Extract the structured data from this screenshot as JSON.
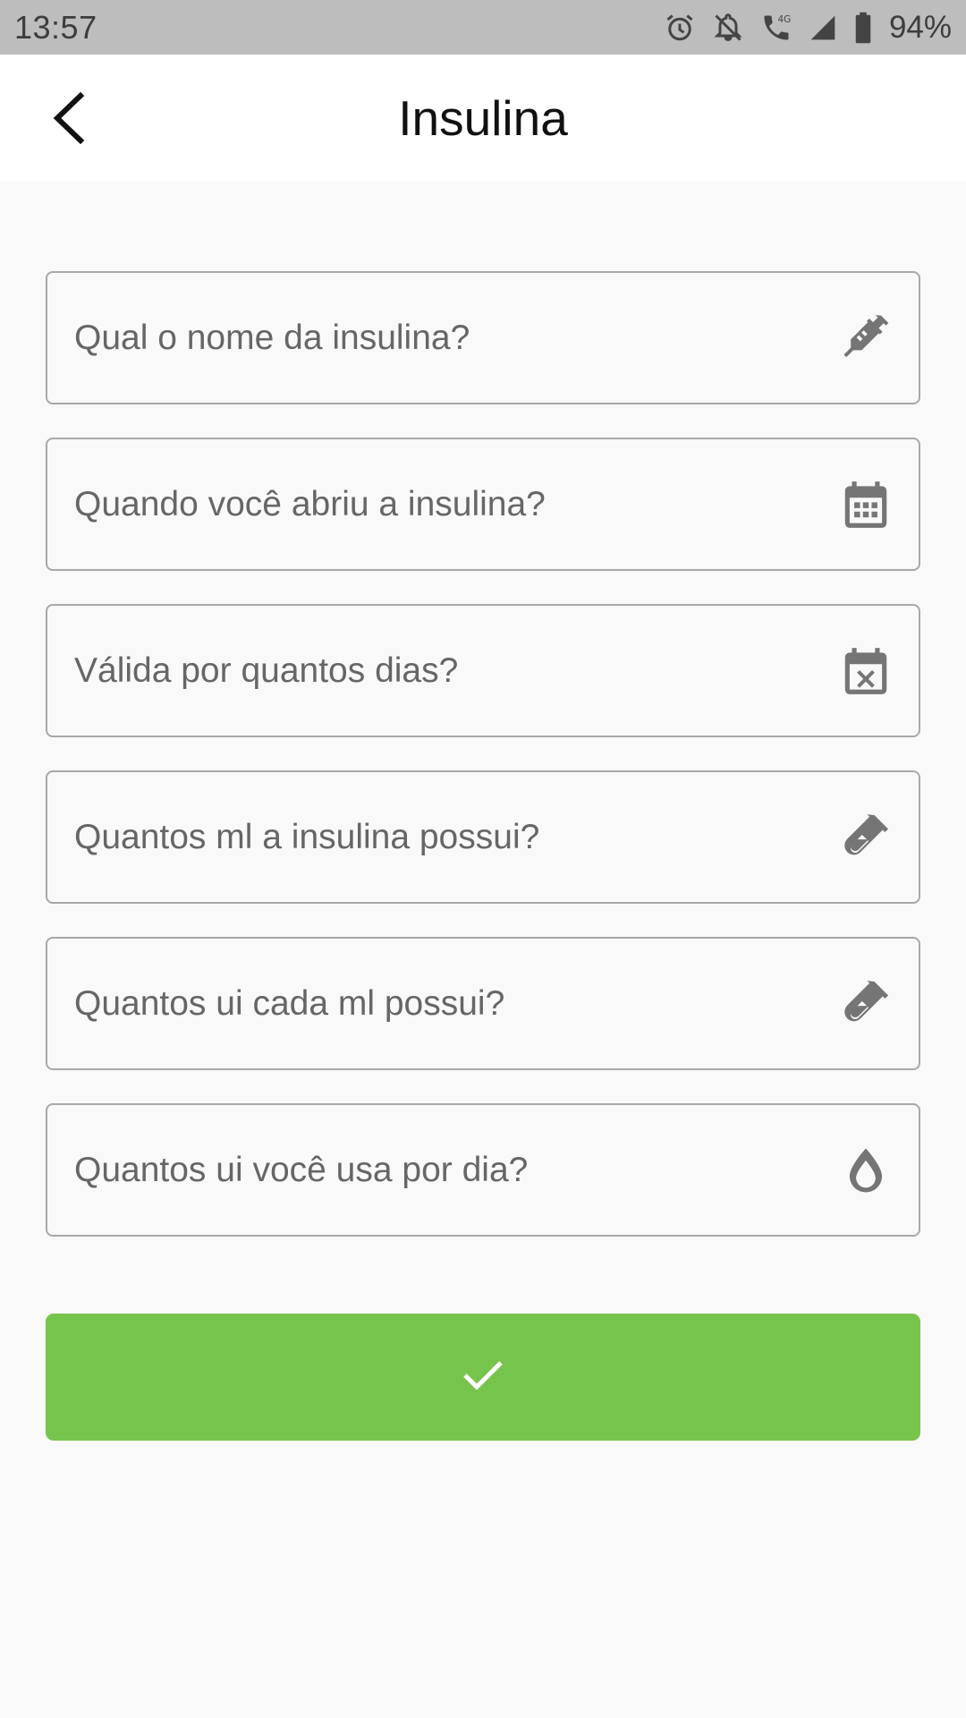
{
  "status_bar": {
    "time": "13:57",
    "battery": "94%",
    "network": "4G",
    "icons": [
      "alarm-icon",
      "notifications-off-icon",
      "call-4g-icon",
      "signal-icon",
      "battery-icon"
    ]
  },
  "app_bar": {
    "title": "Insulina",
    "back_icon": "chevron-left-icon"
  },
  "form": {
    "fields": [
      {
        "placeholder": "Qual o nome da insulina?",
        "value": "",
        "icon": "syringe-icon"
      },
      {
        "placeholder": "Quando você abriu a insulina?",
        "value": "",
        "icon": "calendar-icon"
      },
      {
        "placeholder": "Válida por quantos dias?",
        "value": "",
        "icon": "calendar-remove-icon"
      },
      {
        "placeholder": "Quantos ml a insulina possui?",
        "value": "",
        "icon": "test-tube-icon"
      },
      {
        "placeholder": "Quantos ui cada ml possui?",
        "value": "",
        "icon": "test-tube-icon"
      },
      {
        "placeholder": "Quantos ui você usa por dia?",
        "value": "",
        "icon": "water-drop-icon"
      }
    ]
  },
  "confirm_button": {
    "icon": "check-icon"
  },
  "colors": {
    "status_bar_bg": "#bdbdbd",
    "app_bar_bg": "#ffffff",
    "page_bg": "#f9f9f9",
    "field_border": "#a8a8a8",
    "icon_gray": "#757575",
    "accent_green": "#77c44c"
  }
}
